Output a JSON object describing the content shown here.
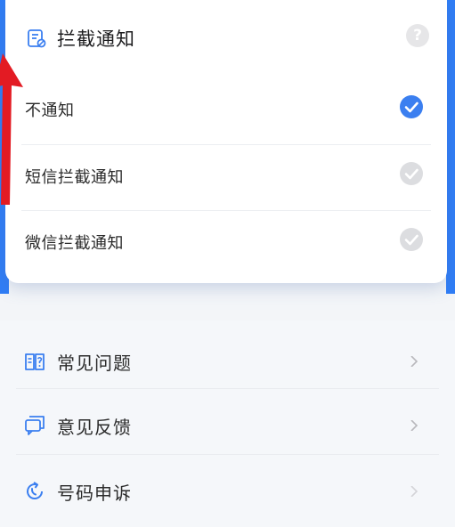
{
  "popup": {
    "title": "拦截通知",
    "help_icon": "?",
    "options": [
      {
        "label": "不通知",
        "checked": true
      },
      {
        "label": "短信拦截通知",
        "checked": false
      },
      {
        "label": "微信拦截通知",
        "checked": false
      }
    ]
  },
  "menu": {
    "items": [
      {
        "label": "常见问题",
        "icon": "book-question-icon"
      },
      {
        "label": "意见反馈",
        "icon": "chat-bubble-icon"
      },
      {
        "label": "号码申诉",
        "icon": "refresh-phone-icon"
      }
    ]
  },
  "colors": {
    "accent": "#3b7ff0",
    "unchecked": "#dcdde0",
    "arrow": "#e31b23"
  }
}
